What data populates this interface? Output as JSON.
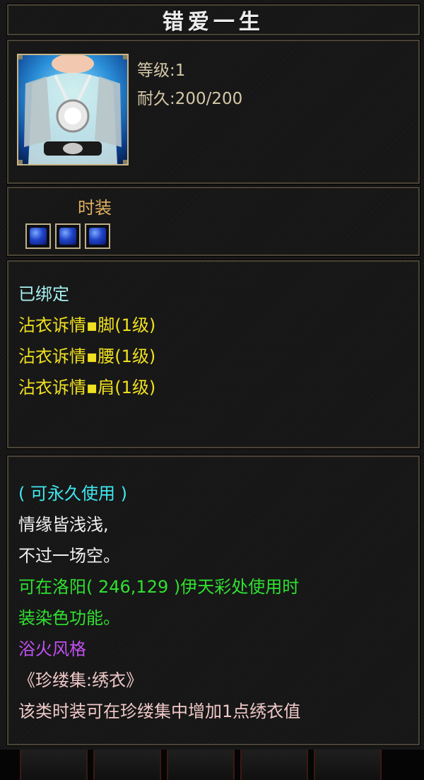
{
  "title": "错爱一生",
  "stats": {
    "level": "等级:1",
    "durability": "耐久:200/200"
  },
  "item_type": "时装",
  "sockets": [
    {
      "icon": "blue-gem-icon"
    },
    {
      "icon": "blue-gem-icon"
    },
    {
      "icon": "blue-gem-icon"
    }
  ],
  "bind_section": {
    "bound": "已绑定",
    "effects": [
      "沾衣诉情▪脚(1级)",
      "沾衣诉情▪腰(1级)",
      "沾衣诉情▪肩(1级)"
    ]
  },
  "description": {
    "usage": "( 可永久使用 )",
    "poem_1": "情缘皆浅浅,",
    "poem_2": "不过一场空。",
    "dye_1": "可在洛阳( 246,129 )伊天彩处使用时",
    "dye_2": "装染色功能。",
    "style": "浴火风格",
    "collection": "《珍缕集:绣衣》",
    "collection_note": "该类时装可在珍缕集中增加1点绣衣值"
  },
  "colors": {
    "stat": "#d4c8a8",
    "type": "#e0b060",
    "bound": "#a8f0f0",
    "effect": "#f0e020",
    "usage": "#40e8f0",
    "poem": "#f0f0f0",
    "dye": "#30e030",
    "style": "#c050f0",
    "collection": "#f0c8c8"
  }
}
